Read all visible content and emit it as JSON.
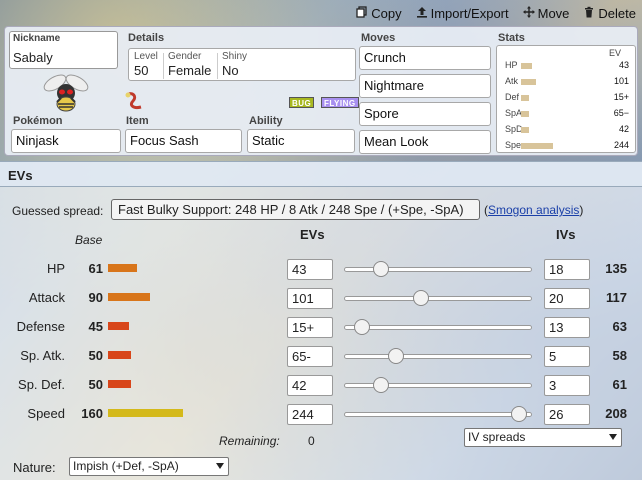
{
  "toolbar": {
    "copy": "Copy",
    "import_export": "Import/Export",
    "move": "Move",
    "delete": "Delete"
  },
  "set": {
    "nickname_label": "Nickname",
    "nickname": "Sabaly",
    "details_label": "Details",
    "level_label": "Level",
    "level": "50",
    "gender_label": "Gender",
    "gender": "Female",
    "shiny_label": "Shiny",
    "shiny": "No",
    "pokemon_label": "Pokémon",
    "pokemon": "Ninjask",
    "item_label": "Item",
    "item": "Focus Sash",
    "ability_label": "Ability",
    "ability": "Static",
    "types": [
      "BUG",
      "FLYING"
    ],
    "type_colors": [
      "#a8b820",
      "#a890f0"
    ],
    "moves_label": "Moves",
    "moves": [
      "Crunch",
      "Nightmare",
      "Spore",
      "Mean Look"
    ],
    "stats_label": "Stats",
    "stats_ev_header": "EV",
    "stats": [
      {
        "name": "HP",
        "ev": "43",
        "fill": 0.15
      },
      {
        "name": "Atk",
        "ev": "101",
        "fill": 0.22
      },
      {
        "name": "Def",
        "ev": "15+",
        "fill": 0.12
      },
      {
        "name": "SpA",
        "ev": "65−",
        "fill": 0.12
      },
      {
        "name": "SpD",
        "ev": "42",
        "fill": 0.12
      },
      {
        "name": "Spe",
        "ev": "244",
        "fill": 0.45
      }
    ]
  },
  "evs": {
    "header": "EVs",
    "guessed_label": "Guessed spread:",
    "guessed_value": "Fast Bulky Support: 248 HP / 8 Atk / 248 Spe / (+Spe, -SpA)",
    "paren_open": "(",
    "smogon_link": "Smogon analysis",
    "paren_close": ")",
    "col_base": "Base",
    "col_evs": "EVs",
    "col_ivs": "IVs",
    "rows": [
      {
        "name": "HP",
        "base": "61",
        "base_value": 61,
        "bar_color": "#d8751a",
        "ev": "43",
        "ev_value": 43,
        "iv": "18",
        "total": "135"
      },
      {
        "name": "Attack",
        "base": "90",
        "base_value": 90,
        "bar_color": "#d8751a",
        "ev": "101",
        "ev_value": 101,
        "iv": "20",
        "total": "117"
      },
      {
        "name": "Defense",
        "base": "45",
        "base_value": 45,
        "bar_color": "#d8461a",
        "ev": "15+",
        "ev_value": 15,
        "iv": "13",
        "total": "63"
      },
      {
        "name": "Sp. Atk.",
        "base": "50",
        "base_value": 50,
        "bar_color": "#d8461a",
        "ev": "65-",
        "ev_value": 65,
        "iv": "5",
        "total": "58"
      },
      {
        "name": "Sp. Def.",
        "base": "50",
        "base_value": 50,
        "bar_color": "#d8461a",
        "ev": "42",
        "ev_value": 42,
        "iv": "3",
        "total": "61"
      },
      {
        "name": "Speed",
        "base": "160",
        "base_value": 160,
        "bar_color": "#d4b91a",
        "ev": "244",
        "ev_value": 244,
        "iv": "26",
        "total": "208"
      }
    ],
    "ev_max": 252,
    "remaining_label": "Remaining:",
    "remaining": "0",
    "iv_spreads": "IV spreads",
    "nature_label": "Nature:",
    "nature": "Impish (+Def, -SpA)"
  }
}
